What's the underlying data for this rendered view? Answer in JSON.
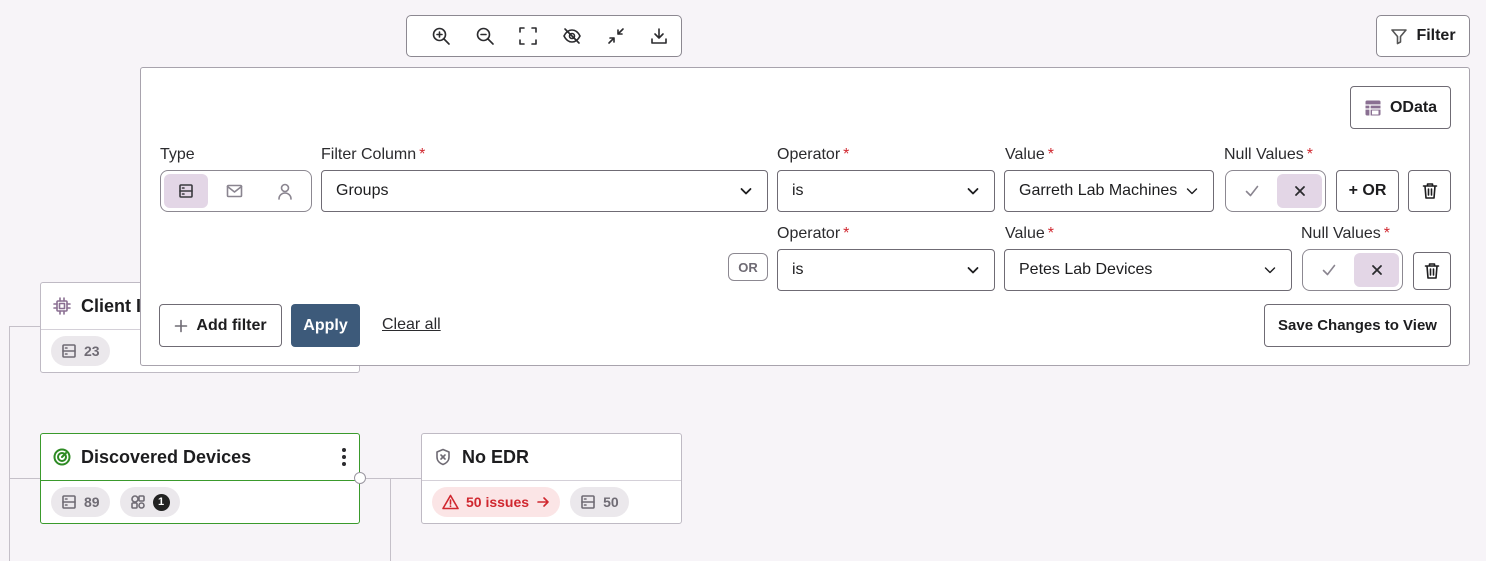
{
  "toolbar": {
    "icons": [
      "zoom-in-icon",
      "zoom-out-icon",
      "fit-screen-icon",
      "hide-icon",
      "collapse-icon",
      "download-icon"
    ]
  },
  "filter_button": {
    "label": "Filter",
    "icon": "funnel-icon"
  },
  "nodes": {
    "client": {
      "title": "Client I",
      "icon": "chip-icon",
      "count": "23"
    },
    "discovered": {
      "title": "Discovered Devices",
      "icon": "radar-icon",
      "count": "89",
      "badge": "1"
    },
    "no_edr": {
      "title": "No EDR",
      "icon": "shield-x-icon",
      "issues": "50 issues",
      "count": "50"
    }
  },
  "panel": {
    "odata_label": "OData",
    "type_label": "Type",
    "filter_column_label": "Filter Column",
    "operator_label": "Operator",
    "value_label": "Value",
    "null_values_label": "Null Values",
    "required_mark": "*",
    "row1": {
      "filter_column": "Groups",
      "operator": "is",
      "value": "Garreth Lab Machines",
      "or_button": "+ OR"
    },
    "row2": {
      "or_chip": "OR",
      "operator": "is",
      "value": "Petes Lab Devices"
    },
    "add_filter_label": "Add filter",
    "apply_label": "Apply",
    "clear_all_label": "Clear all",
    "save_label": "Save Changes to View"
  },
  "colors": {
    "accent_apply": "#3d5a7a",
    "required": "#d0272f",
    "discovered_border": "#3a9a2c",
    "danger": "#d0272f",
    "segment_active": "#e3d6e6"
  }
}
